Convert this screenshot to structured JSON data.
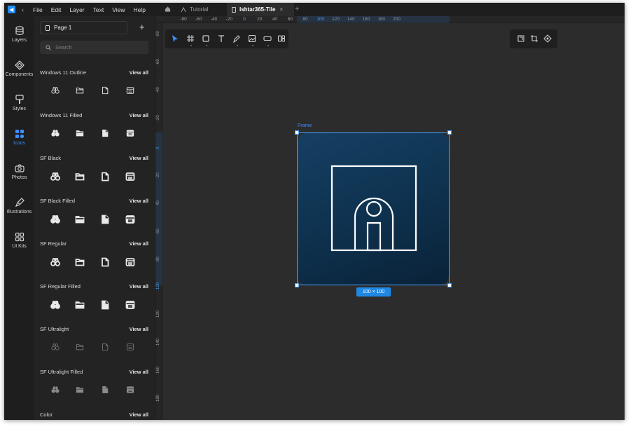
{
  "app": {
    "menu": [
      "File",
      "Edit",
      "Layer",
      "Text",
      "View",
      "Help"
    ],
    "tabs": [
      {
        "label": "Tutorial",
        "active": false
      },
      {
        "label": "Ishtar365-Tile",
        "active": true
      }
    ],
    "tab_close": "×",
    "tab_add": "+"
  },
  "rail": [
    {
      "label": "Layers",
      "icon": "layers-icon",
      "active": false
    },
    {
      "label": "Components",
      "icon": "components-icon",
      "active": false
    },
    {
      "label": "Styles",
      "icon": "styles-icon",
      "active": false
    },
    {
      "label": "Icons",
      "icon": "icons-icon",
      "active": true
    },
    {
      "label": "Photos",
      "icon": "camera-icon",
      "active": false
    },
    {
      "label": "Illustrations",
      "icon": "pen-icon",
      "active": false
    },
    {
      "label": "UI Kits",
      "icon": "grid-icon",
      "active": false
    }
  ],
  "panel": {
    "page_label": "Page 1",
    "add_page": "+",
    "search_placeholder": "Search",
    "view_all": "View all",
    "sections": [
      {
        "title": "Windows 11 Outline",
        "icons": [
          "binoculars-icon",
          "folder-icon",
          "document-icon",
          "calendar-icon"
        ]
      },
      {
        "title": "Windows 11 Filled",
        "icons": [
          "binoculars-icon",
          "folder-icon",
          "document-icon",
          "calendar-icon"
        ]
      },
      {
        "title": "SF Black",
        "icons": [
          "binoculars-icon",
          "folder-icon",
          "document-icon",
          "calendar-icon"
        ]
      },
      {
        "title": "SF Black Filled",
        "icons": [
          "binoculars-icon",
          "folder-icon",
          "document-icon",
          "calendar-icon"
        ]
      },
      {
        "title": "SF Regular",
        "icons": [
          "binoculars-icon",
          "folder-icon",
          "document-icon",
          "calendar-icon"
        ]
      },
      {
        "title": "SF Regular Filled",
        "icons": [
          "binoculars-icon",
          "folder-icon",
          "document-icon",
          "calendar-icon"
        ]
      },
      {
        "title": "SF Ultralight",
        "icons": [
          "binoculars-icon",
          "folder-icon",
          "document-icon",
          "calendar-icon"
        ]
      },
      {
        "title": "SF Ultralight Filled",
        "icons": [
          "binoculars-icon",
          "folder-icon",
          "document-icon",
          "calendar-icon"
        ]
      },
      {
        "title": "Color",
        "icons": []
      }
    ]
  },
  "rulers": {
    "top": [
      "-80",
      "-60",
      "-40",
      "-20",
      "0",
      "20",
      "40",
      "60",
      "80",
      "100",
      "120",
      "140",
      "160",
      "180",
      "200"
    ],
    "left": [
      "-80",
      "-60",
      "-40",
      "-20",
      "0",
      "20",
      "40",
      "60",
      "80",
      "100",
      "120",
      "140",
      "160",
      "180"
    ]
  },
  "canvas": {
    "frame_label": "Frame",
    "size_label": "100 × 100",
    "tile_gradient": [
      "#163f62",
      "#0a2238"
    ],
    "selection_color": "#4aa3ff"
  },
  "toolbar": {
    "tools": [
      "select-tool-icon",
      "frame-tool-icon",
      "rectangle-tool-icon",
      "text-tool-icon",
      "pen-tool-icon",
      "image-tool-icon",
      "button-tool-icon",
      "component-tool-icon"
    ],
    "right_tools": [
      "crop-icon",
      "transform-icon",
      "target-icon"
    ],
    "accent": "#3d8dff"
  }
}
